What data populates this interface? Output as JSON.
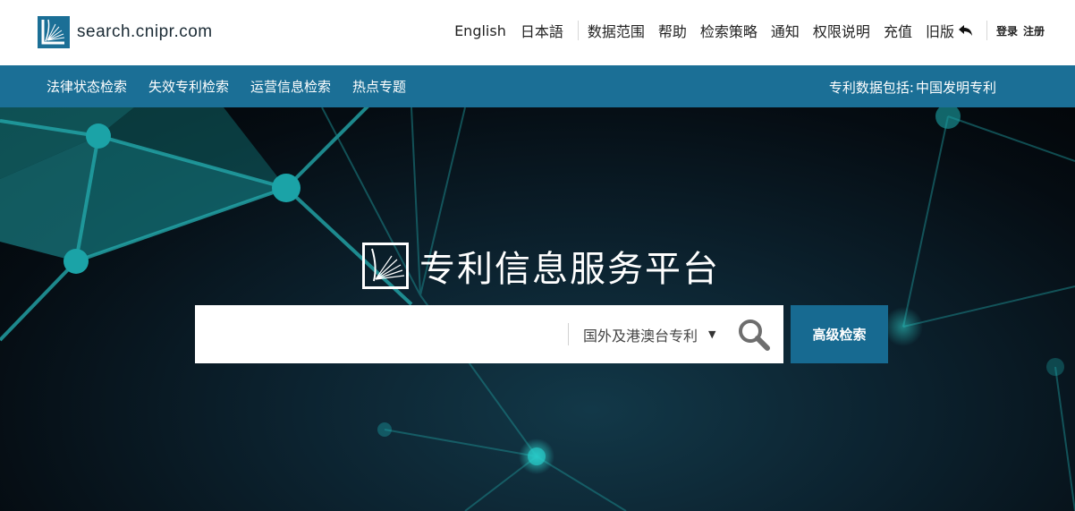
{
  "header": {
    "logo_text": "search.cnipr.com",
    "languages": [
      "English",
      "日本語"
    ],
    "links": [
      "数据范围",
      "帮助",
      "检索策略",
      "通知",
      "权限说明",
      "充值"
    ],
    "old_version": "旧版",
    "login": "登录",
    "register": "注册"
  },
  "nav": {
    "items": [
      "法律状态检索",
      "失效专利检索",
      "运营信息检索",
      "热点专题"
    ],
    "info_label": "专利数据包括:",
    "info_value": "中国发明专利"
  },
  "hero": {
    "title": "专利信息服务平台",
    "search": {
      "placeholder": "",
      "scope_selected": "国外及港澳台专利"
    },
    "advanced_label": "高级检索"
  },
  "colors": {
    "brand_blue": "#1b6f96",
    "button_blue": "#176a91",
    "teal": "#17a3a3"
  },
  "icons": [
    "logo-mark-icon",
    "undo-arrow-icon",
    "caret-down-icon",
    "magnifier-icon"
  ]
}
